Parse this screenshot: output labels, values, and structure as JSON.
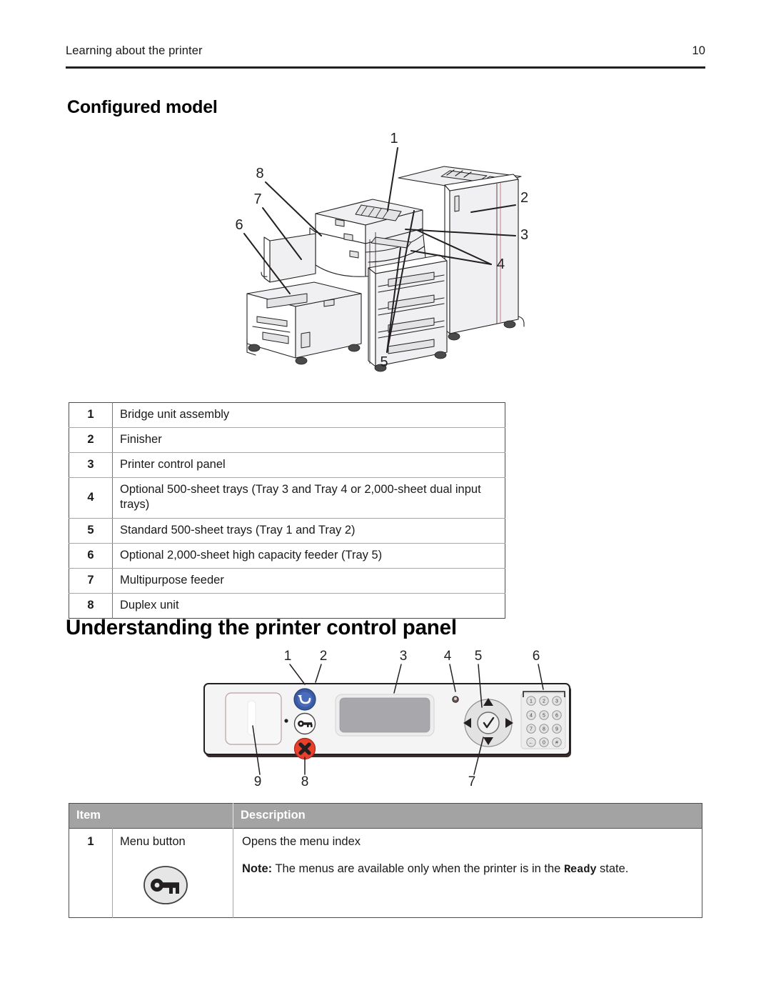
{
  "header": {
    "section_title": "Learning about the printer",
    "page_number": "10"
  },
  "headings": {
    "configured_model": "Configured model",
    "control_panel": "Understanding the printer control panel"
  },
  "printer_diagram": {
    "name": "configured-model-illustration",
    "callouts": [
      "1",
      "2",
      "3",
      "4",
      "5",
      "6",
      "7",
      "8"
    ]
  },
  "parts_table": {
    "rows": [
      {
        "num": "1",
        "description": "Bridge unit assembly"
      },
      {
        "num": "2",
        "description": "Finisher"
      },
      {
        "num": "3",
        "description": "Printer control panel"
      },
      {
        "num": "4",
        "description": "Optional 500-sheet trays (Tray 3 and Tray 4 or 2,000-sheet dual input trays)"
      },
      {
        "num": "5",
        "description": "Standard 500-sheet trays (Tray 1 and Tray 2)"
      },
      {
        "num": "6",
        "description": "Optional 2,000-sheet high capacity feeder (Tray 5)"
      },
      {
        "num": "7",
        "description": "Multipurpose feeder"
      },
      {
        "num": "8",
        "description": "Duplex unit"
      }
    ]
  },
  "control_panel_diagram": {
    "name": "printer-control-panel-illustration",
    "callouts_top": [
      "1",
      "2",
      "3",
      "4",
      "5",
      "6"
    ],
    "callouts_bottom": [
      "9",
      "8",
      "7"
    ],
    "keypad_keys": [
      "1",
      "2",
      "3",
      "4",
      "5",
      "6",
      "7",
      "8",
      "9",
      "←",
      "0",
      "#"
    ],
    "colors": {
      "back_button": "#3b5ba5",
      "stop_button": "#e8402a",
      "panel_body": "#f2f2f2",
      "display": "#a8a8ac",
      "keypad_panel": "#ededed"
    }
  },
  "panel_table": {
    "columns": [
      "Item",
      "Description"
    ],
    "rows": [
      {
        "num": "1",
        "item": "Menu button",
        "icon": "key-icon",
        "description_line": "Opens the menu index",
        "note_label": "Note:",
        "note_text_before": " The menus are available only when the printer is in the ",
        "note_mono": "Ready",
        "note_text_after": " state."
      }
    ]
  }
}
